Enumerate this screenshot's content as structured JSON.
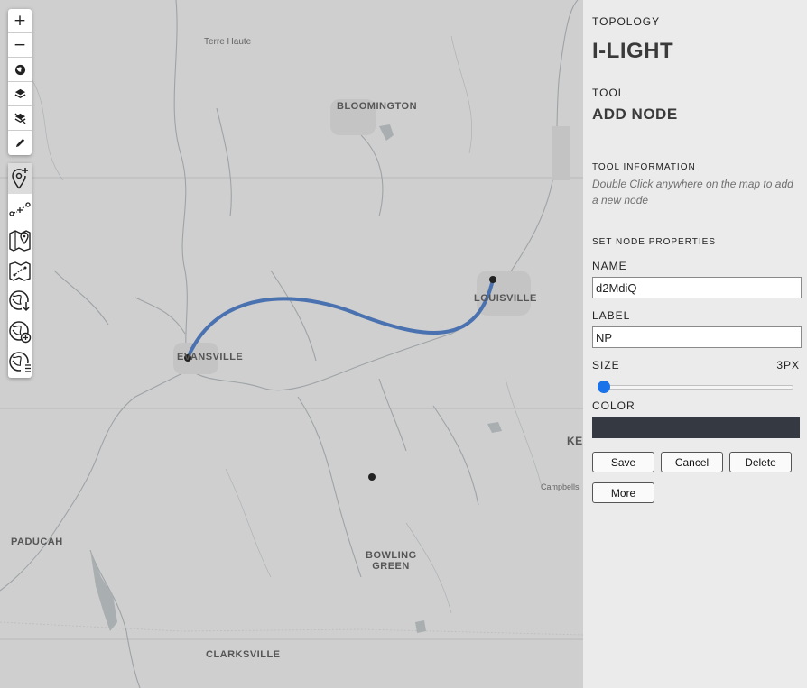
{
  "map": {
    "cities": {
      "terre_haute": "Terre Haute",
      "bloomington": "BLOOMINGTON",
      "louisville": "LOUISVILLE",
      "evansville": "EVANSVILLE",
      "paducah": "PADUCAH",
      "bowling_green_1": "BOWLING",
      "bowling_green_2": "GREEN",
      "clarksville": "CLARKSVILLE",
      "campbellsville": "Campbells",
      "ke": "KE"
    },
    "link_color": "#4a72b0",
    "node_color": "#222222"
  },
  "toolbar": {
    "zoom_in": "+",
    "zoom_out": "−",
    "icons": [
      "globe-icon",
      "layers-icon",
      "layers-off-icon",
      "pencil-icon",
      "add-node-icon",
      "add-link-icon",
      "map-pin-icon",
      "map-route-icon",
      "globe-download-icon",
      "globe-add-icon",
      "globe-list-icon"
    ]
  },
  "panel": {
    "topology_label": "TOPOLOGY",
    "topology_value": "I-LIGHT",
    "tool_label": "TOOL",
    "tool_value": "ADD NODE",
    "tool_info_label": "TOOL INFORMATION",
    "tool_info_text": "Double Click anywhere on the map to add a new node",
    "set_props_label": "SET NODE PROPERTIES",
    "name_label": "NAME",
    "name_value": "d2MdiQ",
    "label_label": "LABEL",
    "label_value": "NP",
    "size_label": "SIZE",
    "size_value": "3PX",
    "size_fraction": 0.03,
    "color_label": "COLOR",
    "color_value": "#353a42",
    "save": "Save",
    "cancel": "Cancel",
    "delete": "Delete",
    "more": "More"
  }
}
